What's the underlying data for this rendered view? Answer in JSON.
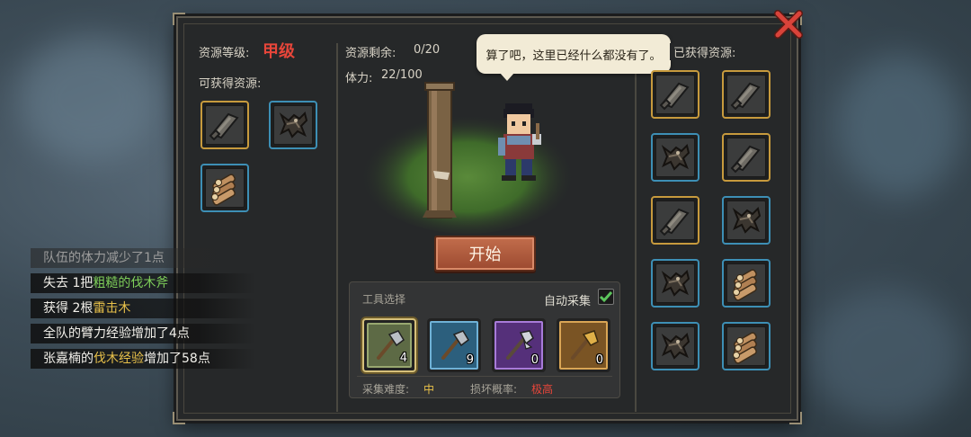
{
  "left_column": {
    "grade_label": "资源等级:",
    "grade_value": "甲级",
    "obtainable_label": "可获得资源:",
    "resources": [
      {
        "icon": "rough-wood-icon",
        "frame": "gold"
      },
      {
        "icon": "thunder-wood-icon",
        "frame": "blue"
      },
      {
        "icon": "log-bundle-icon",
        "frame": "blue"
      }
    ]
  },
  "center": {
    "remaining_label": "资源剩余:",
    "remaining_value": "0/20",
    "stamina_label": "体力:",
    "stamina_value": "22/100",
    "speech": "算了吧，这里已经什么都没有了。",
    "start_button": "开始"
  },
  "tools": {
    "title": "工具选择",
    "auto_collect_label": "自动采集",
    "auto_collect_checked": true,
    "items": [
      {
        "icon": "axe-icon",
        "count": "4",
        "color": "green",
        "selected": true
      },
      {
        "icon": "axe-icon",
        "count": "9",
        "color": "blue",
        "selected": false
      },
      {
        "icon": "halberd-axe-icon",
        "count": "0",
        "color": "purple",
        "selected": false
      },
      {
        "icon": "golden-axe-icon",
        "count": "0",
        "color": "orange",
        "selected": false
      }
    ],
    "difficulty_label": "采集难度:",
    "difficulty_value": "中",
    "break_label": "损坏概率:",
    "break_value": "极高"
  },
  "right_column": {
    "header": "已获得资源:",
    "items": [
      {
        "icon": "rough-wood-icon",
        "frame": "gold"
      },
      {
        "icon": "rough-wood-icon",
        "frame": "gold"
      },
      {
        "icon": "thunder-wood-icon",
        "frame": "blue"
      },
      {
        "icon": "rough-wood-icon",
        "frame": "gold"
      },
      {
        "icon": "rough-wood-icon",
        "frame": "gold"
      },
      {
        "icon": "thunder-wood-icon",
        "frame": "blue"
      },
      {
        "icon": "thunder-wood-icon",
        "frame": "blue"
      },
      {
        "icon": "log-bundle-icon",
        "frame": "blue"
      },
      {
        "icon": "thunder-wood-icon",
        "frame": "blue"
      },
      {
        "icon": "log-bundle-icon",
        "frame": "blue"
      }
    ]
  },
  "log": [
    {
      "parts": [
        {
          "text": "队伍的体力减少了1点",
          "c": ""
        }
      ],
      "faded": true
    },
    {
      "parts": [
        {
          "text": "失去 1把",
          "c": ""
        },
        {
          "text": "粗糙的伐木斧",
          "c": "g"
        }
      ],
      "faded": false
    },
    {
      "parts": [
        {
          "text": "获得 2根",
          "c": ""
        },
        {
          "text": "雷击木",
          "c": "y"
        }
      ],
      "faded": false
    },
    {
      "parts": [
        {
          "text": "全队的臂力经验增加了4点",
          "c": ""
        }
      ],
      "faded": false
    },
    {
      "parts": [
        {
          "text": "张嘉楠的",
          "c": ""
        },
        {
          "text": "伐木经验",
          "c": "y"
        },
        {
          "text": "增加了58点",
          "c": ""
        }
      ],
      "faded": false
    }
  ],
  "colors": {
    "grade": "#e8463a",
    "difficulty": "#e8c14a",
    "break": "#e8463a",
    "close": "#d9433a"
  }
}
